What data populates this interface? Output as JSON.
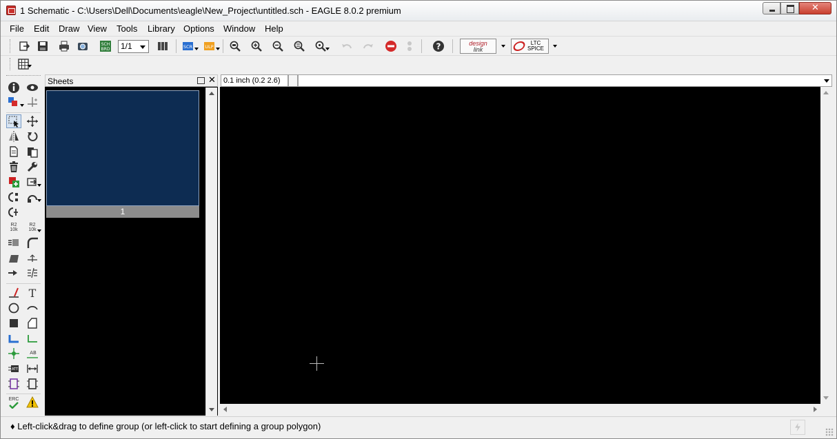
{
  "window": {
    "title": "1 Schematic - C:\\Users\\Dell\\Documents\\eagle\\New_Project\\untitled.sch - EAGLE 8.0.2 premium",
    "close_glyph": "✕"
  },
  "menu": [
    "File",
    "Edit",
    "Draw",
    "View",
    "Tools",
    "Library",
    "Options",
    "Window",
    "Help"
  ],
  "toolbar": {
    "sch_brd_label_top": "SCH",
    "sch_brd_label_bottom": "BRD",
    "sheet_select_value": "1/1",
    "scr_label": "SCR",
    "ulp_label": "ULP",
    "designlink_label_top": "design",
    "designlink_label_bottom": "link",
    "ltspice_label_top": "LTC",
    "ltspice_label_bottom": "SPICE"
  },
  "sheets_panel": {
    "title": "Sheets",
    "close_glyph": "✕",
    "sheets": [
      {
        "label": "1",
        "selected": true
      }
    ]
  },
  "canvas": {
    "grid_readout": "0.1 inch (0.2 2.6)",
    "command_value": ""
  },
  "palette_labels": {
    "value_tool": "R2\n10k",
    "erc": "ERC",
    "label_ab": "AB",
    "attribute_att": "ATT"
  },
  "status": {
    "message": "♦ Left-click&drag to define group (or left-click to start defining a group polygon)"
  },
  "colors": {
    "canvas_bg": "#000000",
    "sheet_thumb": "#0d2c52",
    "stop_red": "#d42a2a",
    "ulp_orange": "#f0a020",
    "scr_blue": "#2a6fd1",
    "green_tool": "#2a9a3a"
  }
}
